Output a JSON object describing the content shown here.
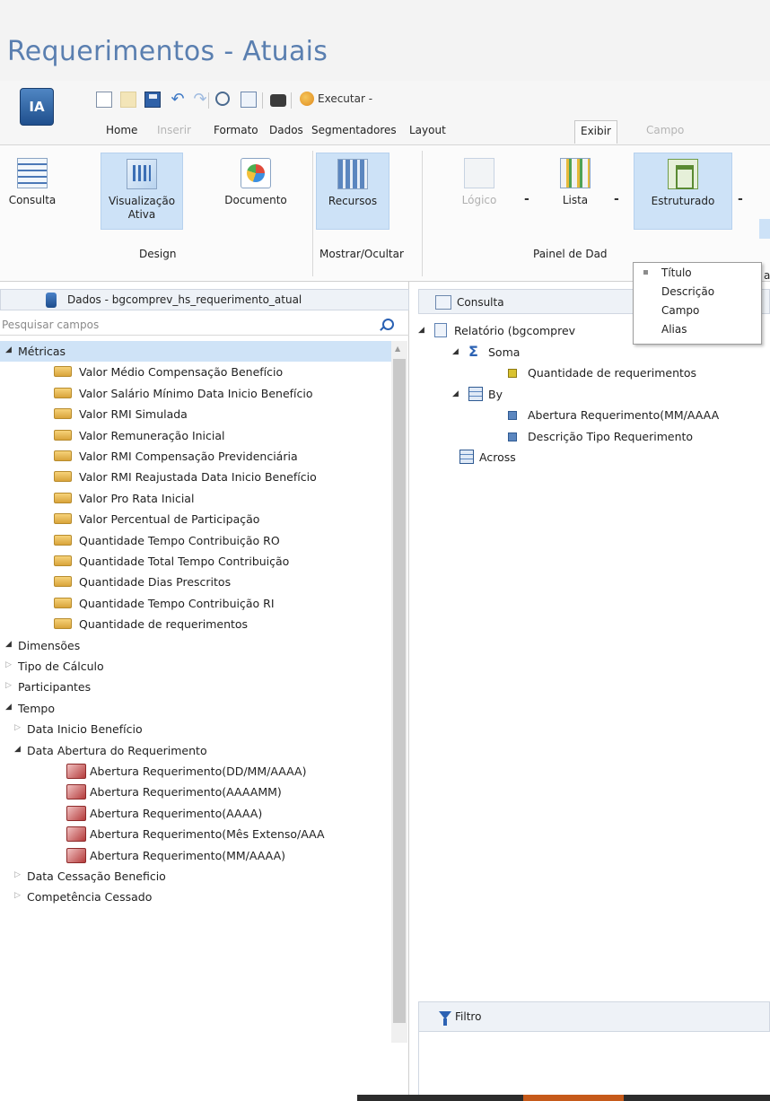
{
  "page_title": "Requerimentos - Atuais",
  "app_logo": "IA",
  "quick_access": {
    "executar_label": "Executar -"
  },
  "tabs": [
    {
      "label": "Home",
      "state": "normal"
    },
    {
      "label": "Inserir",
      "state": "disabled"
    },
    {
      "label": "Formato",
      "state": "normal"
    },
    {
      "label": "Dados",
      "state": "normal"
    },
    {
      "label": "Segmentadores",
      "state": "normal"
    },
    {
      "label": "Layout",
      "state": "normal"
    },
    {
      "label": "Exibir",
      "state": "active"
    },
    {
      "label": "Campo",
      "state": "disabled"
    }
  ],
  "ribbon": {
    "design": {
      "group_label": "Design",
      "buttons": [
        {
          "label_line1": "Consulta",
          "label_line2": ""
        },
        {
          "label_line1": "Visualização",
          "label_line2": "Ativa"
        },
        {
          "label_line1": "Documento",
          "label_line2": ""
        }
      ]
    },
    "mostrar": {
      "group_label": "Mostrar/Ocultar",
      "buttons": [
        {
          "label_line1": "Recursos"
        }
      ]
    },
    "painel": {
      "group_label": "Painel de Dad",
      "buttons": [
        {
          "label_line1": "Lógico",
          "dash": "-"
        },
        {
          "label_line1": "Lista",
          "dash": "-"
        },
        {
          "label_line1": "Estruturado",
          "dash": "-"
        }
      ]
    },
    "dropdown": {
      "items": [
        "Título",
        "Descrição",
        "Campo",
        "Alias"
      ],
      "cut_text": "a"
    }
  },
  "data_panel": {
    "header": "Dados - bgcomprev_hs_requerimento_atual",
    "search_placeholder": "Pesquisar campos",
    "tree": [
      {
        "label": "Métricas",
        "type": "group",
        "expanded": true,
        "level": 0,
        "selected": true
      },
      {
        "label": "Valor Médio Compensação Benefício",
        "type": "metric",
        "level": 1
      },
      {
        "label": "Valor Salário Mínimo Data Inicio Benefício",
        "type": "metric",
        "level": 1
      },
      {
        "label": "Valor RMI Simulada",
        "type": "metric",
        "level": 1
      },
      {
        "label": "Valor Remuneração Inicial",
        "type": "metric",
        "level": 1
      },
      {
        "label": "Valor RMI Compensação Previdenciária",
        "type": "metric",
        "level": 1
      },
      {
        "label": "Valor RMI Reajustada Data Inicio Benefício",
        "type": "metric",
        "level": 1
      },
      {
        "label": "Valor Pro Rata Inicial",
        "type": "metric",
        "level": 1
      },
      {
        "label": "Valor Percentual de Participação",
        "type": "metric",
        "level": 1
      },
      {
        "label": "Quantidade Tempo Contribuição RO",
        "type": "metric",
        "level": 1
      },
      {
        "label": "Quantidade Total Tempo Contribuição",
        "type": "metric",
        "level": 1
      },
      {
        "label": "Quantidade Dias Prescritos",
        "type": "metric",
        "level": 1
      },
      {
        "label": "Quantidade Tempo Contribuição RI",
        "type": "metric",
        "level": 1
      },
      {
        "label": "Quantidade de requerimentos",
        "type": "metric",
        "level": 1
      },
      {
        "label": "Dimensões",
        "type": "group",
        "expanded": true,
        "level": 0
      },
      {
        "label": "Tipo de Cálculo",
        "type": "group",
        "expanded": false,
        "level": 0
      },
      {
        "label": "Participantes",
        "type": "group",
        "expanded": false,
        "level": 0
      },
      {
        "label": "Tempo",
        "type": "group",
        "expanded": true,
        "level": 0
      },
      {
        "label": "Data Inicio Benefício",
        "type": "group",
        "expanded": false,
        "level": 1
      },
      {
        "label": "Data Abertura do Requerimento",
        "type": "group",
        "expanded": true,
        "level": 1
      },
      {
        "label": "Abertura Requerimento(DD/MM/AAAA)",
        "type": "date",
        "level": 2
      },
      {
        "label": "Abertura Requerimento(AAAAMM)",
        "type": "date",
        "level": 2
      },
      {
        "label": "Abertura Requerimento(AAAA)",
        "type": "date",
        "level": 2
      },
      {
        "label": "Abertura Requerimento(Mês Extenso/AAA",
        "type": "date",
        "level": 2
      },
      {
        "label": "Abertura Requerimento(MM/AAAA)",
        "type": "date",
        "level": 2
      },
      {
        "label": "Data Cessação Beneficio",
        "type": "group",
        "expanded": false,
        "level": 1
      },
      {
        "label": "Competência Cessado",
        "type": "group",
        "expanded": false,
        "level": 1
      }
    ]
  },
  "query_panel": {
    "header": "Consulta",
    "tree": [
      {
        "label": "Relatório (bgcomprev",
        "icon": "report",
        "level": 0,
        "expanded": true
      },
      {
        "label": "Soma",
        "icon": "sigma",
        "level": 1,
        "expanded": true
      },
      {
        "label": "Quantidade de requerimentos",
        "icon": "field-yellow",
        "level": 2
      },
      {
        "label": "By",
        "icon": "grid",
        "level": 1,
        "expanded": true
      },
      {
        "label": "Abertura Requerimento(MM/AAAA",
        "icon": "field-blue",
        "level": 2
      },
      {
        "label": "Descrição Tipo Requerimento",
        "icon": "field-blue",
        "level": 2
      },
      {
        "label": "Across",
        "icon": "grid",
        "level": 1
      }
    ],
    "filter_header": "Filtro"
  }
}
